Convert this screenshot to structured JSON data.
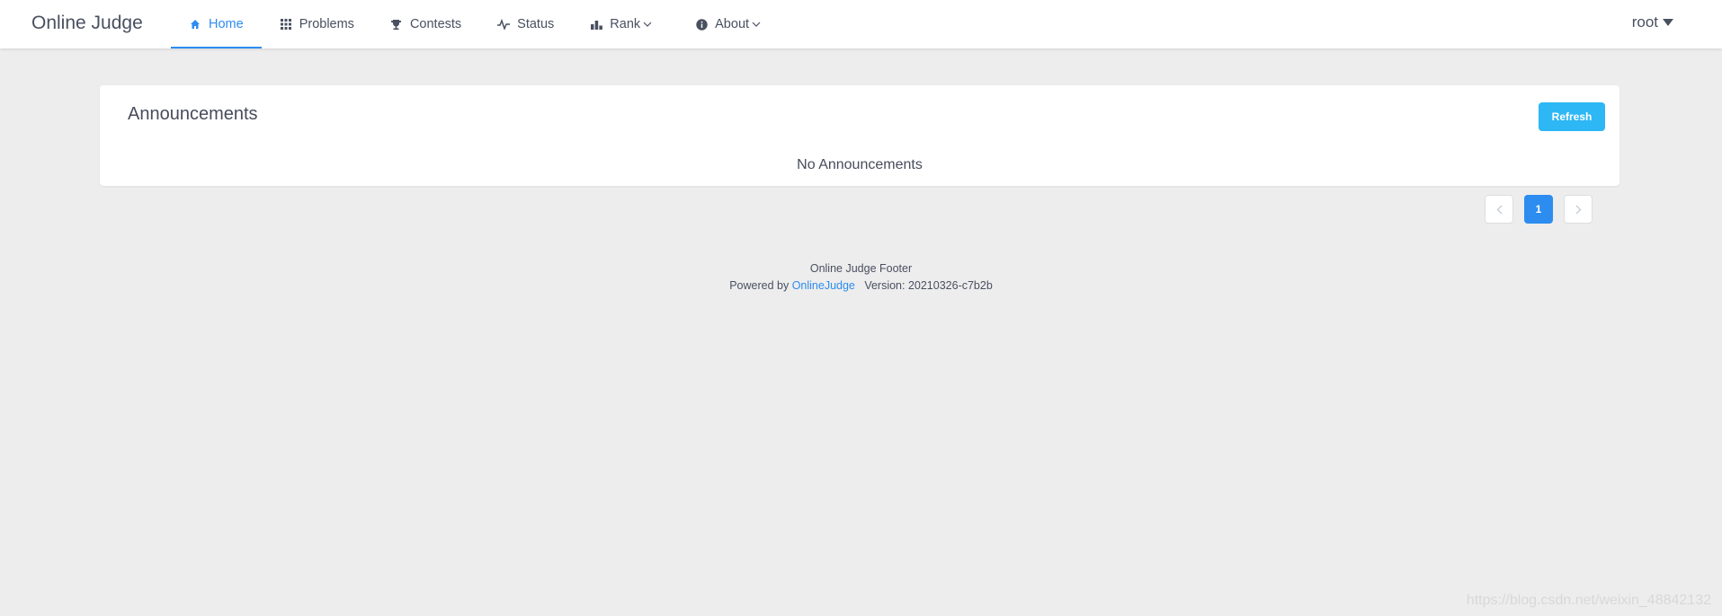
{
  "header": {
    "logo": "Online Judge",
    "nav": [
      {
        "label": "Home",
        "icon": "home-icon",
        "active": true
      },
      {
        "label": "Problems",
        "icon": "grid-icon"
      },
      {
        "label": "Contests",
        "icon": "trophy-icon"
      },
      {
        "label": "Status",
        "icon": "pulse-icon"
      },
      {
        "label": "Rank",
        "icon": "bar-chart-icon",
        "dropdown": true
      },
      {
        "label": "About",
        "icon": "info-icon",
        "dropdown": true
      }
    ],
    "user": "root"
  },
  "announcements": {
    "title": "Announcements",
    "refresh_label": "Refresh",
    "empty_text": "No Announcements"
  },
  "pagination": {
    "current_page": "1",
    "prev_icon": "chevron-left-icon",
    "next_icon": "chevron-right-icon"
  },
  "footer": {
    "line1": "Online Judge Footer",
    "powered_by": "Powered by",
    "link_text": "OnlineJudge",
    "version": "Version: 20210326-c7b2b"
  },
  "watermark": "https://blog.csdn.net/weixin_48842132",
  "colors": {
    "accent": "#2d8cf0",
    "refresh": "#2db7f5",
    "background": "#ededed"
  }
}
